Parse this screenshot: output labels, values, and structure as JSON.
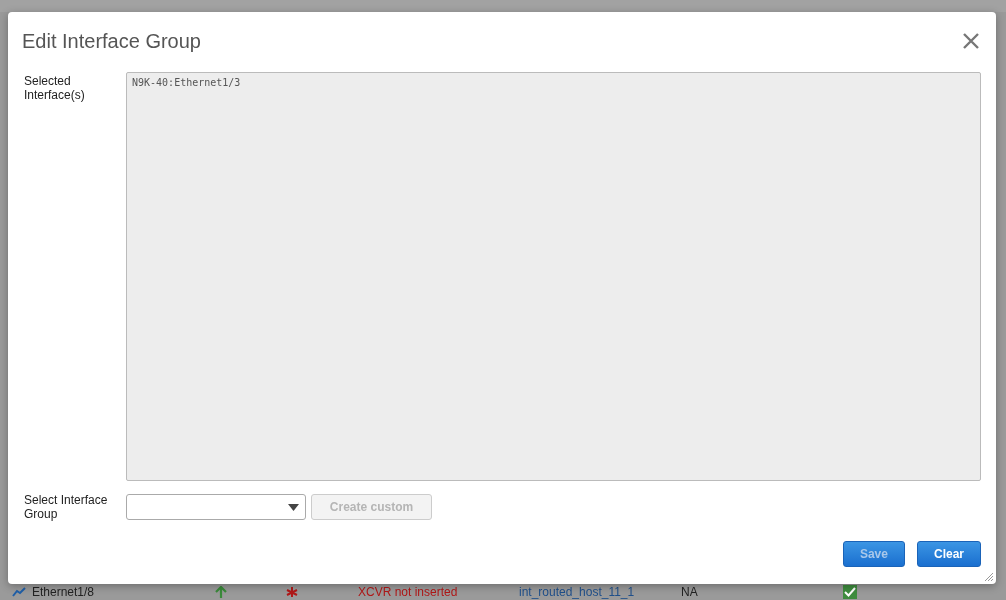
{
  "dialog": {
    "title": "Edit Interface Group",
    "selected_interfaces": {
      "label": "Selected Interface(s)",
      "value": "N9K-40:Ethernet1/3"
    },
    "interface_group": {
      "label": "Select Interface Group"
    },
    "create_custom": {
      "label": "Create custom",
      "disabled": true
    },
    "buttons": [
      {
        "label": "Save",
        "disabled": true
      },
      {
        "label": "Clear",
        "disabled": false
      }
    ]
  },
  "background_row": {
    "interface": "Ethernet1/8",
    "reason": "XCVR not inserted",
    "policy": "int_routed_host_11_1",
    "column_6": "NA",
    "checked": true
  }
}
